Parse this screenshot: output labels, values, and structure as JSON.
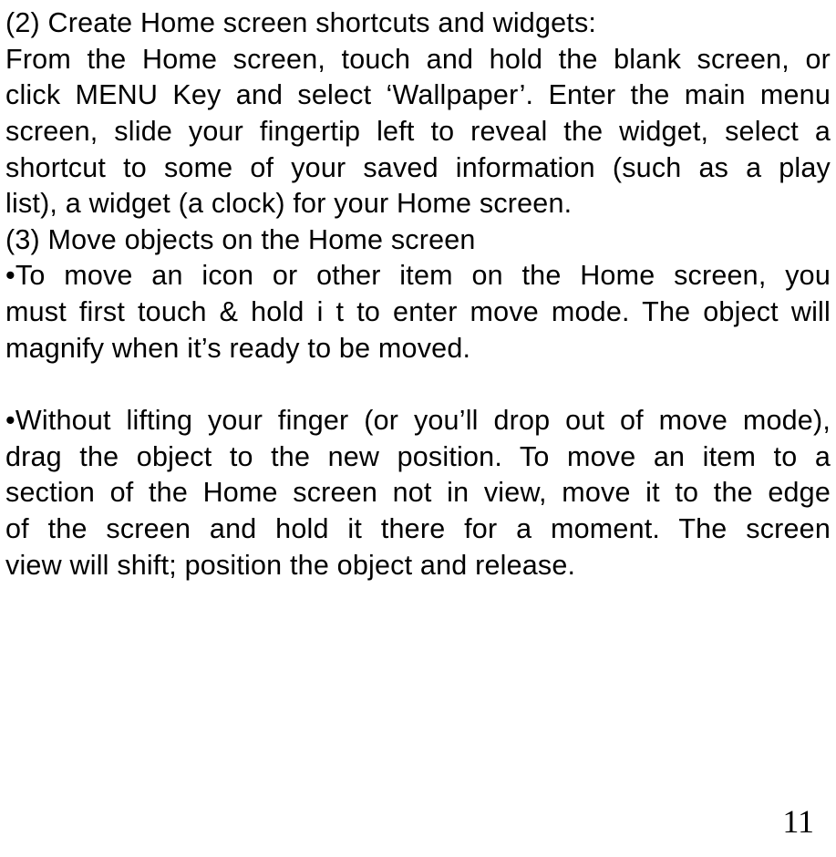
{
  "lines": {
    "l1": "(2) Create Home screen shortcuts and widgets:",
    "l2": "From the Home screen, touch and hold the blank screen, or",
    "l3": "click MENU Key and select ‘Wallpaper’. Enter the main menu",
    "l4": "screen, slide your fingertip left to reveal the widget, select a",
    "l5": "shortcut to some of your saved information (such as a play",
    "l6": "list), a widget (a clock) for your Home screen.",
    "l7": "(3) Move objects on the Home screen",
    "l8": "•To move an icon or other item on the Home screen, you",
    "l9": "must first touch & hold i t to enter move mode. The object will",
    "l10": "magnify when it’s ready to be moved.",
    "l11": "•Without lifting your finger (or you’ll drop out of move mode),",
    "l12": "drag the object to the new position. To move an item to a",
    "l13": "section of the Home screen not in view, move it to the edge",
    "l14": "of the screen and hold it there for a moment. The screen",
    "l15": "view will shift; position the object and release."
  },
  "pageNumber": "11"
}
